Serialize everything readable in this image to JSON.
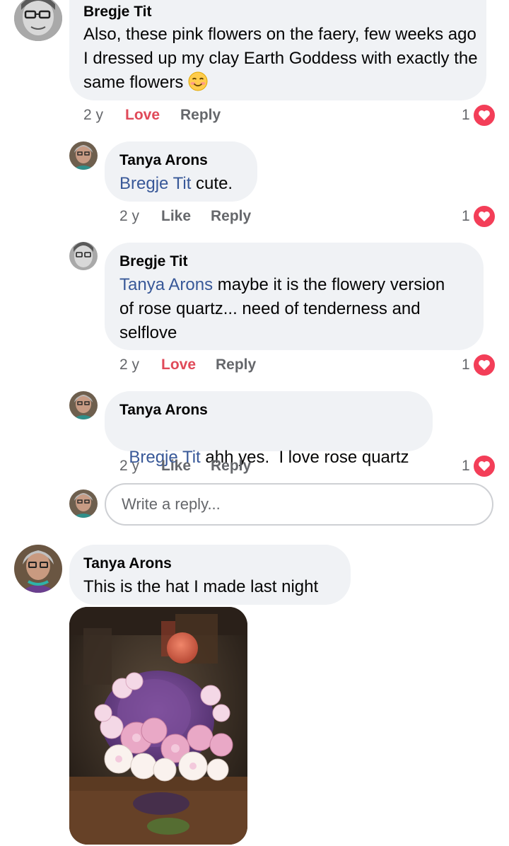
{
  "comments": [
    {
      "author": "Bregje Tit",
      "text": "Also, these pink flowers on the faery, few weeks ago I dressed up my clay Earth Goddess with exactly the same flowers",
      "emoji": "blush-emoji",
      "time": "2 y",
      "reaction_action": "Love",
      "reply_action": "Reply",
      "reaction_count": "1",
      "reaction_icon": "heart-icon"
    },
    {
      "author": "Tanya Arons",
      "mention": "Bregje Tit",
      "text": " cute.",
      "time": "2 y",
      "reaction_action": "Like",
      "reply_action": "Reply",
      "reaction_count": "1",
      "reaction_icon": "heart-icon"
    },
    {
      "author": "Bregje Tit",
      "mention": "Tanya Arons",
      "text_line1": " maybe it is the flowery version",
      "text_line2": "of rose quartz... need of tenderness and",
      "text_line3": "selflove",
      "time": "2 y",
      "reaction_action": "Love",
      "reply_action": "Reply",
      "reaction_count": "1",
      "reaction_icon": "heart-icon"
    },
    {
      "author": "Tanya Arons",
      "mention": "Bregje Tit",
      "text": " ahh yes.  I love rose quartz",
      "time": "2 y",
      "reaction_action": "Like",
      "reply_action": "Reply",
      "reaction_count": "1",
      "reaction_icon": "heart-icon"
    },
    {
      "author": "Tanya Arons",
      "text": "This is the hat I made last night",
      "photo": "knitted-hat-photo"
    }
  ],
  "reply_input": {
    "placeholder": "Write a reply..."
  },
  "colors": {
    "mention": "#385898",
    "love": "#e04a59",
    "heart": "#f33e58",
    "bubble": "#f0f2f5",
    "muted": "#65676b"
  }
}
